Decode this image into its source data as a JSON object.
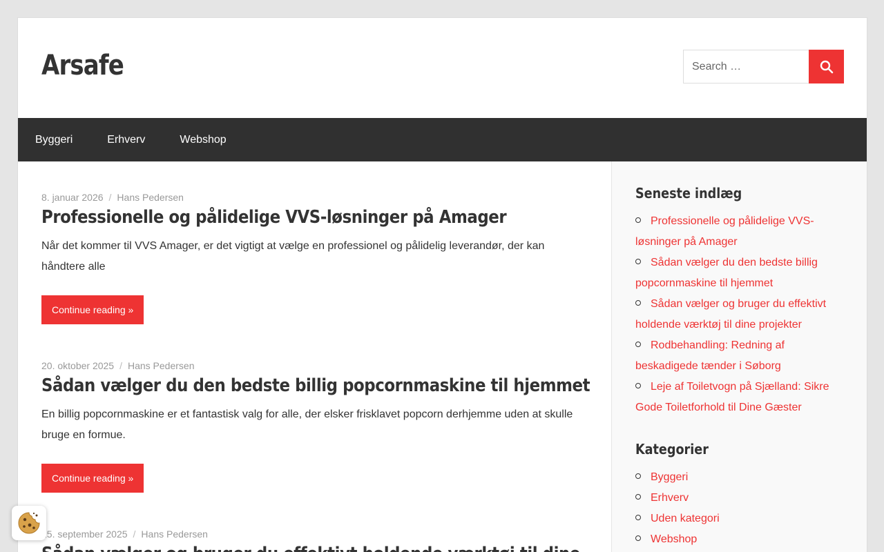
{
  "site": {
    "title": "Arsafe"
  },
  "search": {
    "placeholder": "Search …",
    "button_icon": "search-icon"
  },
  "nav": {
    "items": [
      "Byggeri",
      "Erhverv",
      "Webshop"
    ]
  },
  "posts": [
    {
      "date": "8. januar 2026",
      "separator": "/",
      "author": "Hans Pedersen",
      "title": "Professionelle og pålidelige VVS-løsninger på Amager",
      "excerpt": "Når det kommer til VVS Amager, er det vigtigt at vælge en professionel og pålidelig leverandør, der kan håndtere alle",
      "read_more": "Continue reading »"
    },
    {
      "date": "20. oktober 2025",
      "separator": "/",
      "author": "Hans Pedersen",
      "title": "Sådan vælger du den bedste billig popcornmaskine til hjemmet",
      "excerpt": "En billig popcornmaskine er et fantastisk valg for alle, der elsker frisklavet popcorn derhjemme uden at skulle bruge en formue.",
      "read_more": "Continue reading »"
    },
    {
      "date": "15. september 2025",
      "separator": "/",
      "author": "Hans Pedersen",
      "title": "Sådan vælger og bruger du effektivt holdende værktøj til dine"
    }
  ],
  "sidebar": {
    "recent": {
      "title": "Seneste indlæg",
      "items": [
        "Professionelle og pålidelige VVS-løsninger på Amager",
        "Sådan vælger du den bedste billig popcornmaskine til hjemmet",
        "Sådan vælger og bruger du effektivt holdende værktøj til dine projekter",
        "Rodbehandling: Redning af beskadigede tænder i Søborg",
        "Leje af Toiletvogn på Sjælland: Sikre Gode Toiletforhold til Dine Gæster"
      ]
    },
    "categories": {
      "title": "Kategorier",
      "items": [
        "Byggeri",
        "Erhverv",
        "Uden kategori",
        "Webshop"
      ]
    }
  },
  "colors": {
    "accent": "#ee3333",
    "nav_bg": "#303030",
    "page_bg": "#e5e5e5"
  },
  "cookie": {
    "icon": "cookie-icon"
  }
}
